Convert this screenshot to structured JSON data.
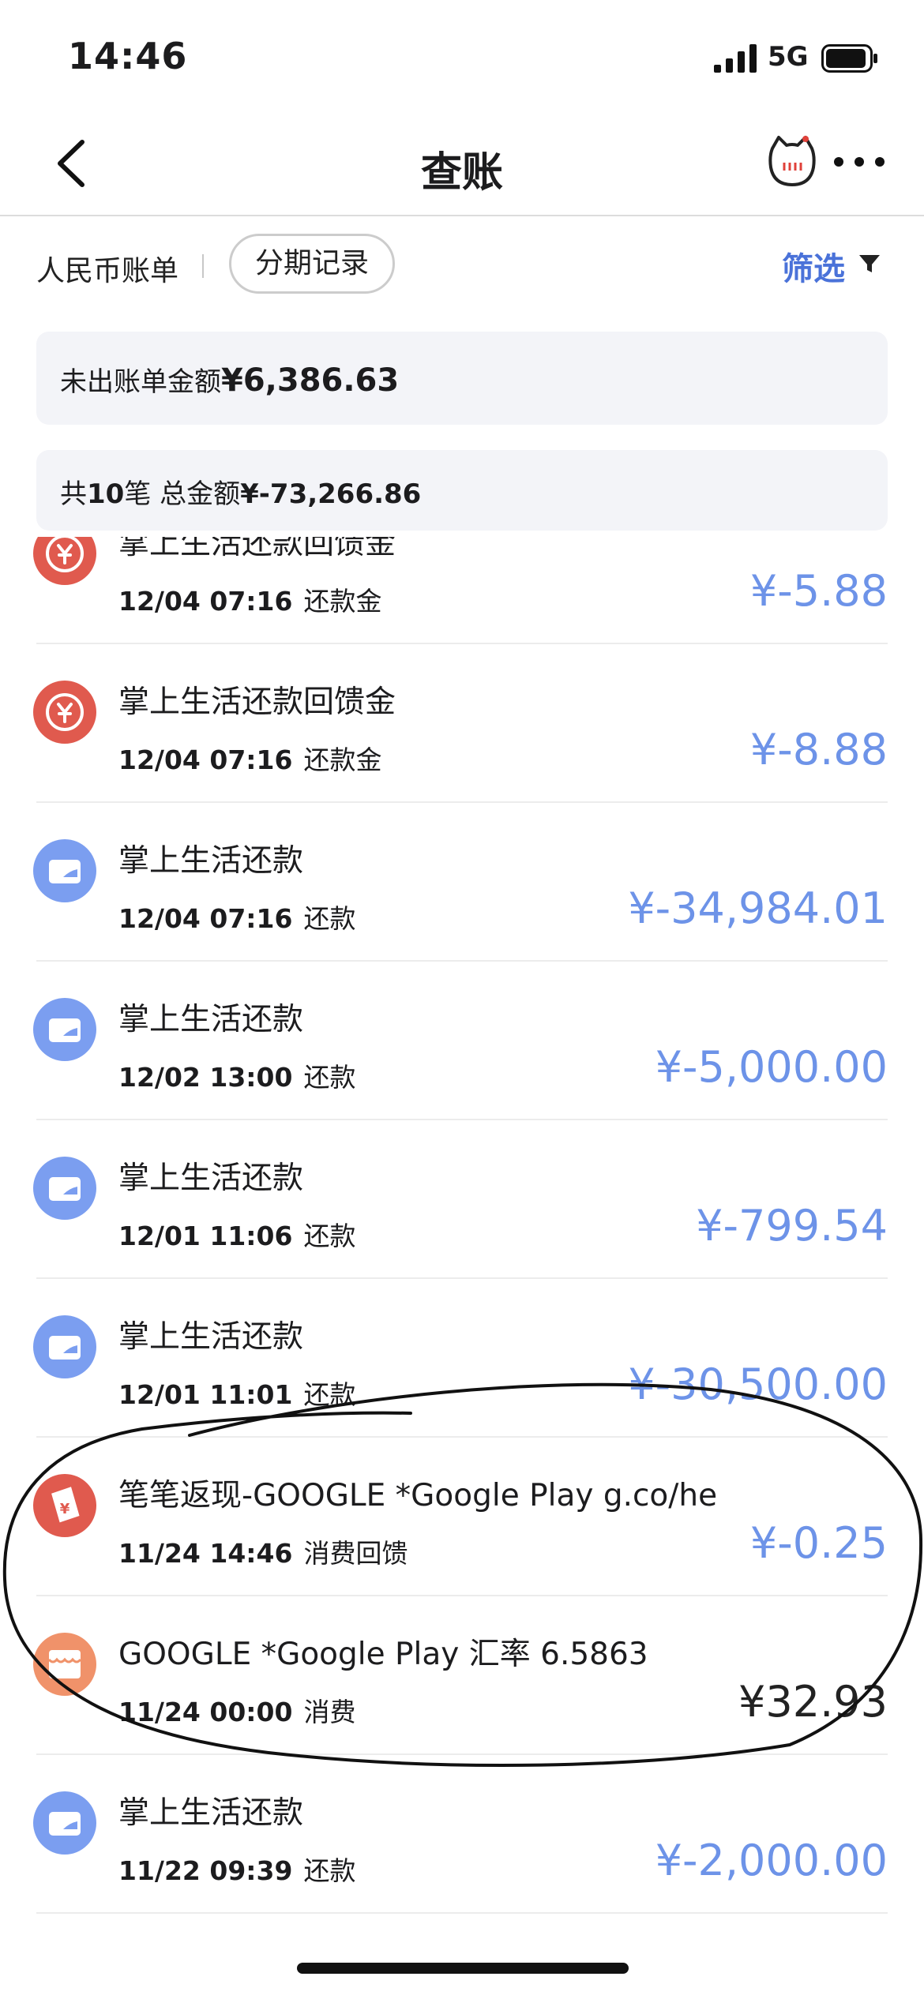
{
  "status_bar": {
    "time": "14:46",
    "network": "5G"
  },
  "nav": {
    "title": "查账"
  },
  "tabs": {
    "rmb_bill": "人民币账单",
    "installment": "分期记录",
    "filter": "筛选"
  },
  "summary": {
    "unbilled_label": "未出账单金额",
    "unbilled_amount": "¥6,386.63",
    "count_prefix": "共",
    "count": "10",
    "count_suffix": "笔 总金额",
    "total_amount": "¥-73,266.86"
  },
  "colors": {
    "accent_blue": "#6d93e8",
    "filter_blue": "#4a72d9",
    "cashback_red": "#e05a4e",
    "shop_orange": "#f0926a",
    "card_bg": "#f3f4f8"
  },
  "transactions": [
    {
      "title": "掌上生活还款回馈金",
      "time": "12/04 07:16",
      "type": "还款金",
      "amount": "¥-5.88",
      "icon": "cashback-coin-icon"
    },
    {
      "title": "掌上生活还款回馈金",
      "time": "12/04 07:16",
      "type": "还款金",
      "amount": "¥-8.88",
      "icon": "cashback-coin-icon"
    },
    {
      "title": "掌上生活还款",
      "time": "12/04 07:16",
      "type": "还款",
      "amount": "¥-34,984.01",
      "icon": "wallet-icon"
    },
    {
      "title": "掌上生活还款",
      "time": "12/02 13:00",
      "type": "还款",
      "amount": "¥-5,000.00",
      "icon": "wallet-icon"
    },
    {
      "title": "掌上生活还款",
      "time": "12/01 11:06",
      "type": "还款",
      "amount": "¥-799.54",
      "icon": "wallet-icon"
    },
    {
      "title": "掌上生活还款",
      "time": "12/01 11:01",
      "type": "还款",
      "amount": "¥-30,500.00",
      "icon": "wallet-icon"
    },
    {
      "title": "笔笔返现-GOOGLE *Google Play   g.co/he",
      "time": "11/24 14:46",
      "type": "消费回馈",
      "amount": "¥-0.25",
      "icon": "cashback-cup-icon"
    },
    {
      "title": "GOOGLE *Google Play      汇率 6.5863",
      "time": "11/24 00:00",
      "type": "消费",
      "amount": "¥32.93",
      "icon": "shop-icon"
    },
    {
      "title": "掌上生活还款",
      "time": "11/22 09:39",
      "type": "还款",
      "amount": "¥-2,000.00",
      "icon": "wallet-icon"
    }
  ]
}
